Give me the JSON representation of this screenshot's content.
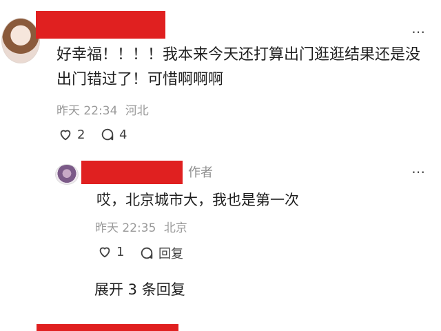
{
  "top_comment": {
    "text_line1": "好幸福！！！！我本来今天还打算出门逛逛结果还是没",
    "text_line2": "出门错过了！可惜啊啊啊",
    "time": "昨天 22:34",
    "location": "河北",
    "likes": "2",
    "replies": "4",
    "more_icon": "more-horizontal-icon",
    "like_icon": "heart-outline-icon",
    "comment_icon": "comment-bubble-icon"
  },
  "reply": {
    "author_tag": "作者",
    "text": "哎，北京城市大，我也是第一次",
    "time": "昨天 22:35",
    "location": "北京",
    "likes": "1",
    "reply_label": "回复",
    "more_icon": "more-horizontal-icon",
    "like_icon": "heart-outline-icon",
    "reply_icon": "reply-bubble-icon"
  },
  "expand": {
    "label": "展开 3 条回复"
  },
  "colors": {
    "redaction": "#e02020",
    "meta_text": "#9a9a9a",
    "body_text": "#1f1f1f"
  }
}
